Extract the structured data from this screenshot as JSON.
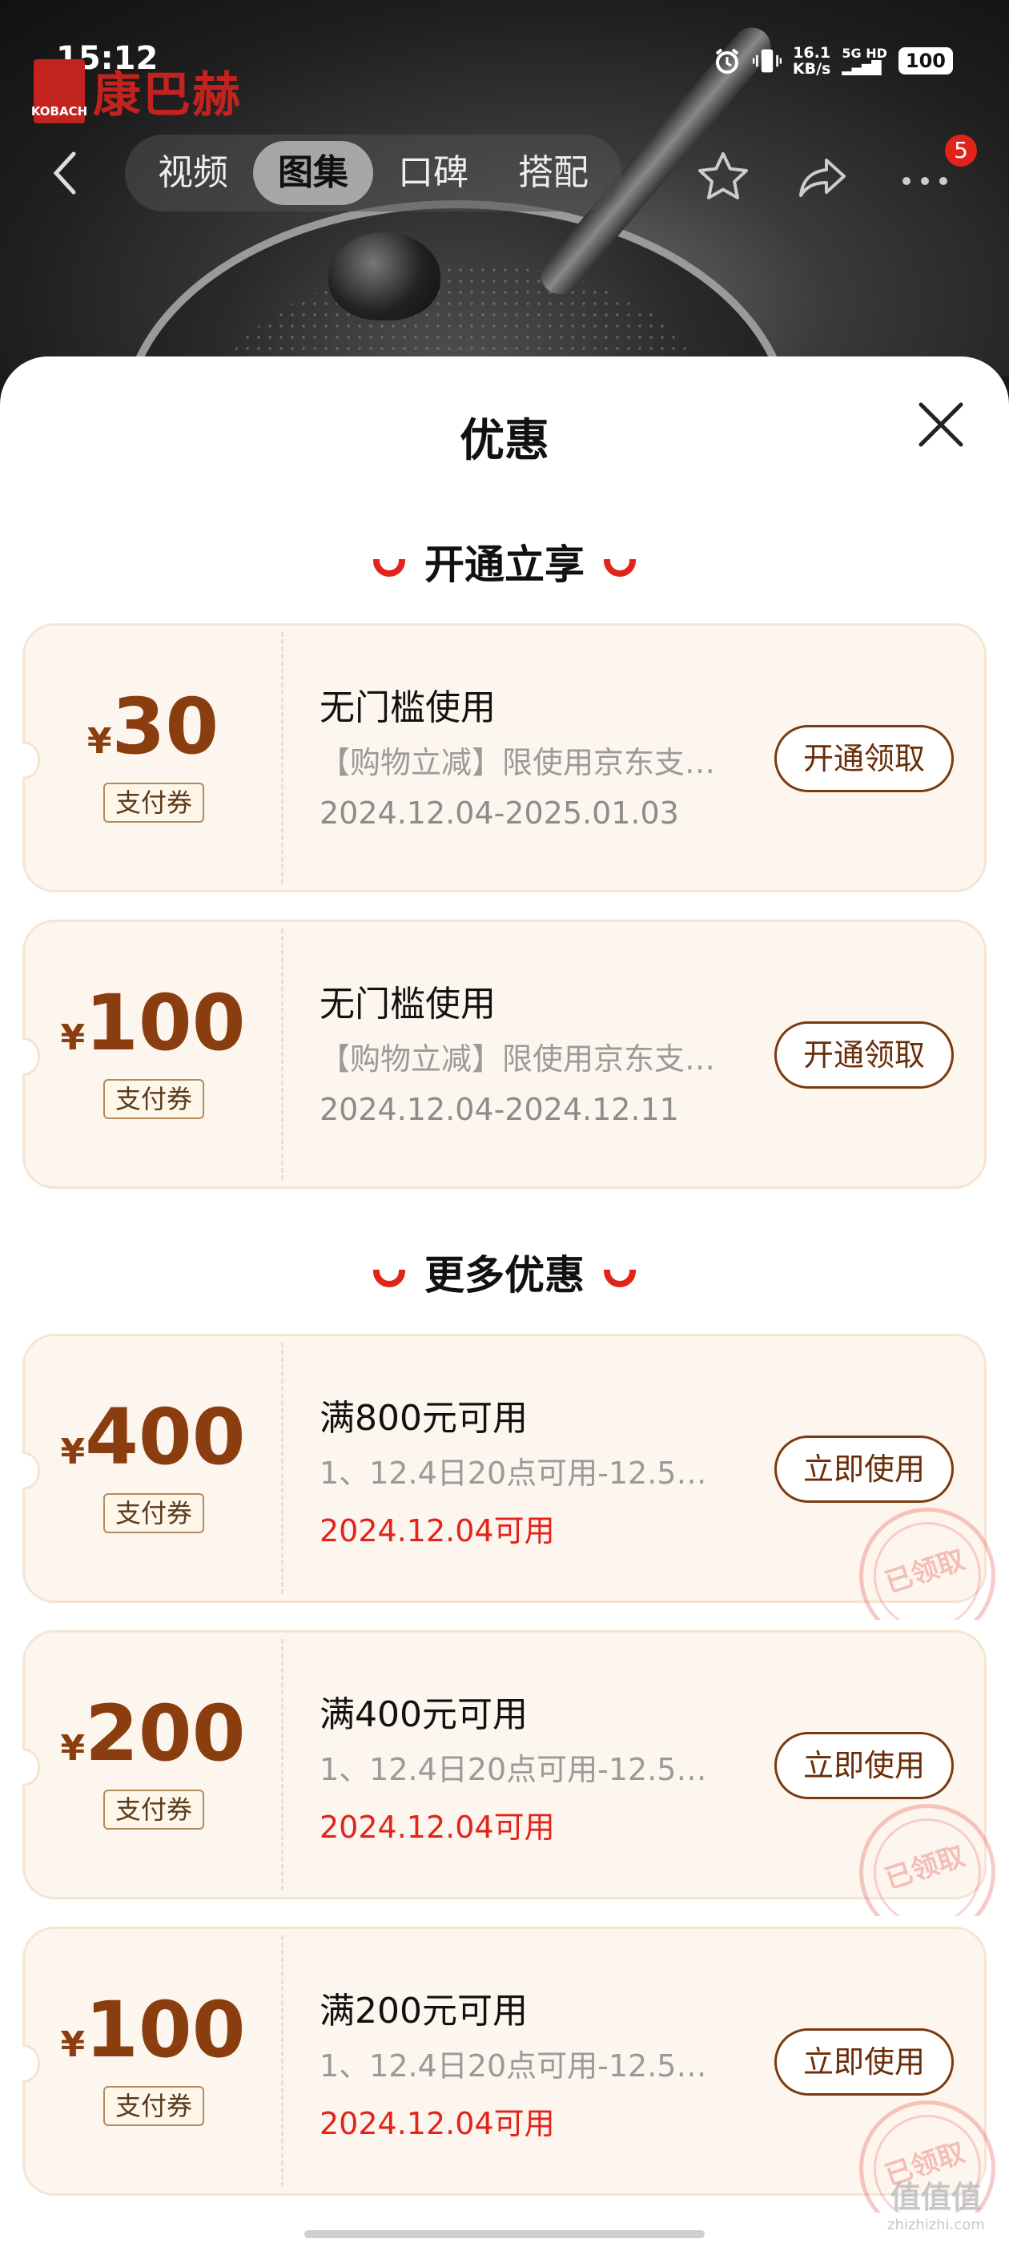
{
  "status_bar": {
    "time": "15:12",
    "net_speed_value": "16.1",
    "net_speed_unit": "KB/s",
    "signal_text": "5G HD",
    "battery": "100"
  },
  "brand": {
    "name": "康巴赫",
    "mark_text": "KOBACH",
    "color": "#c3231e"
  },
  "nav": {
    "tabs": [
      {
        "label": "视频"
      },
      {
        "label": "图集"
      },
      {
        "label": "口碑"
      },
      {
        "label": "搭配"
      }
    ],
    "active_tab": "图集",
    "badge_count": "5"
  },
  "sheet": {
    "title": "优惠",
    "sections": [
      {
        "title": "开通立享",
        "coupons": [
          {
            "currency": "¥",
            "amount": "30",
            "tag": "支付券",
            "title": "无门槛使用",
            "desc": "【购物立减】限使用京东支…",
            "date": "2024.12.04-2025.01.03",
            "date_highlight": false,
            "button": "开通领取",
            "claimed": false
          },
          {
            "currency": "¥",
            "amount": "100",
            "tag": "支付券",
            "title": "无门槛使用",
            "desc": "【购物立减】限使用京东支…",
            "date": "2024.12.04-2024.12.11",
            "date_highlight": false,
            "button": "开通领取",
            "claimed": false
          }
        ]
      },
      {
        "title": "更多优惠",
        "coupons": [
          {
            "currency": "¥",
            "amount": "400",
            "tag": "支付券",
            "title": "满800元可用",
            "desc": "1、12.4日20点可用-12.5…",
            "date": "2024.12.04可用",
            "date_highlight": true,
            "button": "立即使用",
            "claimed": true,
            "stamp": "已领取"
          },
          {
            "currency": "¥",
            "amount": "200",
            "tag": "支付券",
            "title": "满400元可用",
            "desc": "1、12.4日20点可用-12.5…",
            "date": "2024.12.04可用",
            "date_highlight": true,
            "button": "立即使用",
            "claimed": true,
            "stamp": "已领取"
          },
          {
            "currency": "¥",
            "amount": "100",
            "tag": "支付券",
            "title": "满200元可用",
            "desc": "1、12.4日20点可用-12.5…",
            "date": "2024.12.04可用",
            "date_highlight": true,
            "button": "立即使用",
            "claimed": true,
            "stamp": "已领取"
          }
        ]
      }
    ]
  },
  "watermark": {
    "text": "值值值",
    "sub": "zhizhizhi.com"
  },
  "colors": {
    "accent_red": "#e2231a",
    "coupon_brown": "#8a3e0f",
    "coupon_bg": "#fdf6ee"
  }
}
